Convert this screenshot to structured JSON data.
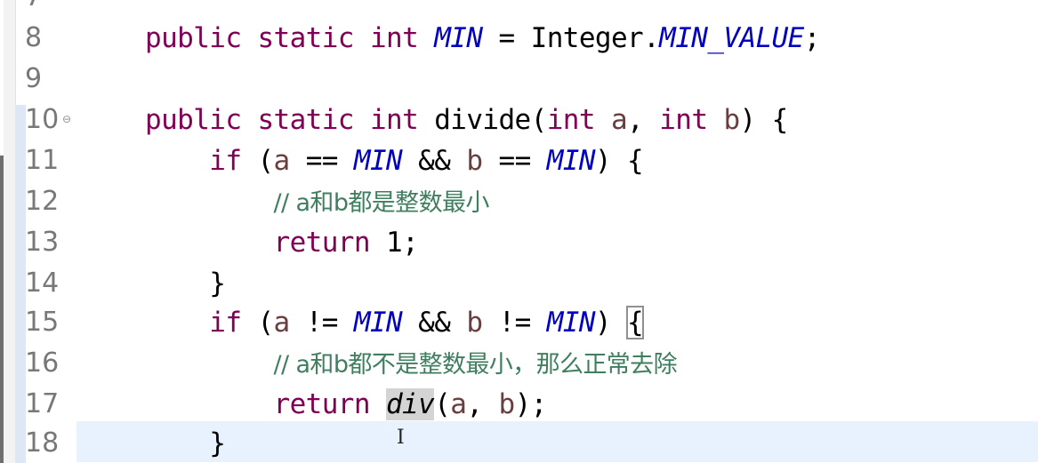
{
  "editor": {
    "lines": [
      {
        "num": "7",
        "text": ""
      },
      {
        "num": "8",
        "text": "public static int MIN = Integer.MIN_VALUE;"
      },
      {
        "num": "9",
        "text": ""
      },
      {
        "num": "10",
        "text": "public static int divide(int a, int b) {"
      },
      {
        "num": "11",
        "text": "if (a == MIN && b == MIN) {"
      },
      {
        "num": "12",
        "text": "// a和b都是整数最小"
      },
      {
        "num": "13",
        "text": "return 1;"
      },
      {
        "num": "14",
        "text": "}"
      },
      {
        "num": "15",
        "text": "if (a != MIN && b != MIN) {"
      },
      {
        "num": "16",
        "text": "// a和b都不是整数最小，那么正常去除"
      },
      {
        "num": "17",
        "text": "return div(a, b);"
      },
      {
        "num": "18",
        "text": "}"
      }
    ],
    "tokens": {
      "public": "public",
      "static": "static",
      "int": "int",
      "if": "if",
      "return": "return",
      "MIN": "MIN",
      "Integer": "Integer",
      "MIN_VALUE": "MIN_VALUE",
      "divide": "divide",
      "div": "div",
      "a": "a",
      "b": "b",
      "one": "1"
    },
    "fold_marker": "⊖",
    "current_line": "18",
    "colors": {
      "keyword": "#7f0055",
      "static_field": "#0000c0",
      "parameter": "#6a3e3e",
      "comment": "#3f7f5f",
      "line_number": "#787878",
      "current_line_bg": "#e8f2fe"
    }
  }
}
